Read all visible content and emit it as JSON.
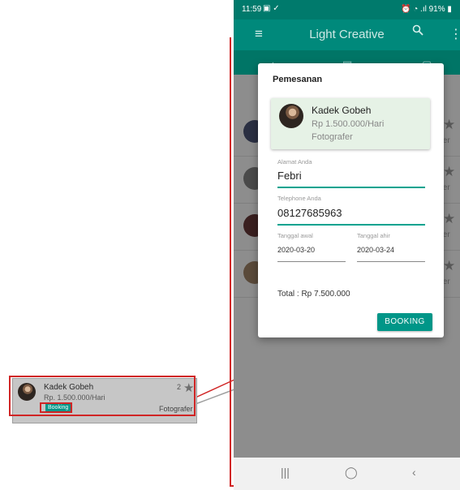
{
  "callout": {
    "name": "Kadek Gobeh",
    "price": "Rp. 1.500.000/Hari",
    "badge": "Booking",
    "count": "2",
    "role": "Fotografer"
  },
  "status_bar": {
    "time": "11:59",
    "right": "91%"
  },
  "app_bar": {
    "title": "Light Creative"
  },
  "background_list": {
    "role_fragment": "fer"
  },
  "dialog": {
    "title": "Pemesanan",
    "card": {
      "name": "Kadek Gobeh",
      "price": "Rp 1.500.000/Hari",
      "role": "Fotografer"
    },
    "address": {
      "label": "Alamat Anda",
      "value": "Febri"
    },
    "phone": {
      "label": "Telephone Anda",
      "value": "08127685963"
    },
    "start": {
      "label": "Tanggal awal",
      "value": "2020-03-20"
    },
    "end": {
      "label": "Tanggal ahir",
      "value": "2020-03-24"
    },
    "total": "Total : Rp 7.500.000",
    "button": "BOOKING"
  },
  "colors": {
    "primary": "#00897b",
    "primary_dark": "#007a6c",
    "annotation": "#d02525"
  },
  "icons": [
    "menu-icon",
    "search-icon",
    "more-vert-icon",
    "star-icon",
    "recent-apps-icon",
    "home-icon",
    "back-icon"
  ]
}
